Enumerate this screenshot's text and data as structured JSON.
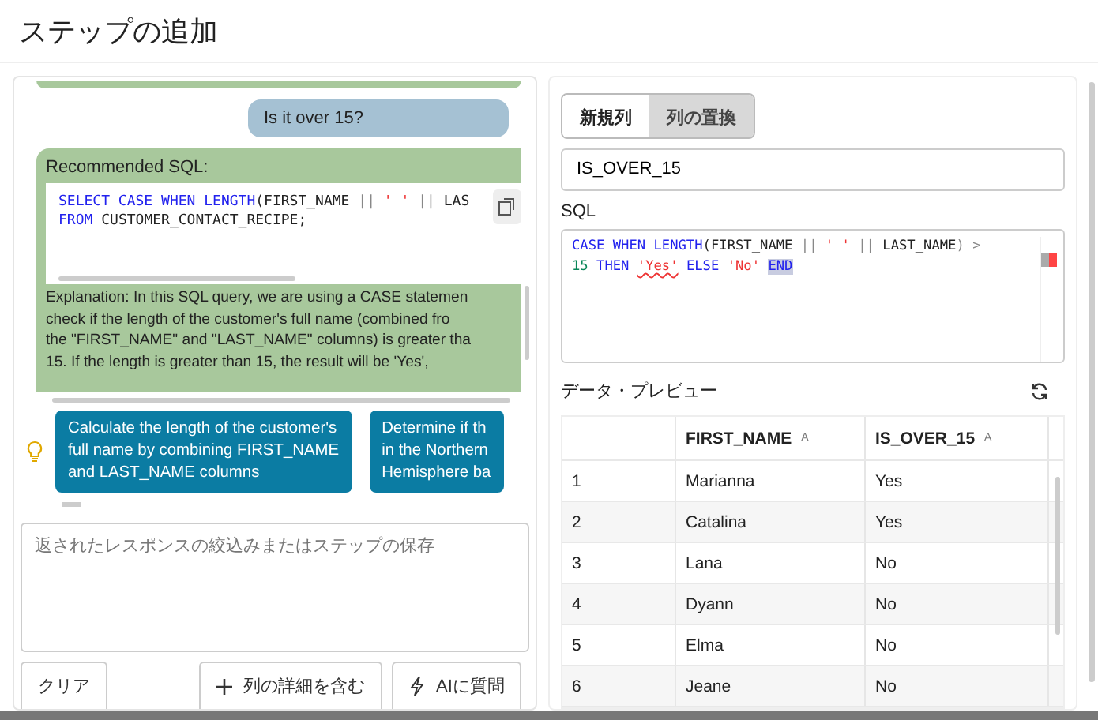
{
  "title": "ステップの追加",
  "chat": {
    "user_message": "Is it over 15?",
    "recommendation": {
      "heading": "Recommended SQL:",
      "code_lines": [
        [
          {
            "kind": "keyword",
            "text": "SELECT CASE WHEN LENGTH"
          },
          {
            "kind": "plain",
            "text": "(FIRST_NAME "
          },
          {
            "kind": "operator",
            "text": "||"
          },
          {
            "kind": "string",
            "text": " ' ' "
          },
          {
            "kind": "operator",
            "text": "||"
          },
          {
            "kind": "plain",
            "text": " LAS"
          }
        ],
        [
          {
            "kind": "keyword",
            "text": "FROM"
          },
          {
            "kind": "plain",
            "text": " CUSTOMER_CONTACT_RECIPE;"
          }
        ]
      ],
      "explanation_lines": [
        "Explanation: In this SQL query, we are using a CASE statemen",
        "check if the length of the customer's full name (combined fro",
        "the \"FIRST_NAME\" and \"LAST_NAME\" columns) is greater tha",
        "15. If the length is greater than 15, the result will be 'Yes',"
      ]
    }
  },
  "suggestions": [
    {
      "lines": [
        "Calculate the length of the customer's",
        "full name by combining FIRST_NAME",
        "and LAST_NAME columns"
      ]
    },
    {
      "lines": [
        "Determine if th",
        "in the Northern",
        "Hemisphere ba"
      ]
    }
  ],
  "prompt": {
    "placeholder": "返されたレスポンスの絞込みまたはステップの保存"
  },
  "buttons": [
    {
      "kind": "plain",
      "label": "クリア"
    },
    {
      "kind": "add",
      "label": "列の詳細を含む"
    },
    {
      "kind": "ai",
      "label": "AIに質問"
    }
  ],
  "tabs": [
    {
      "label": "新規列",
      "selected": true
    },
    {
      "label": "列の置換",
      "selected": false
    }
  ],
  "column_name": "IS_OVER_15",
  "sql_label": "SQL",
  "sql_lines": [
    [
      {
        "kind": "keyword",
        "text": "CASE WHEN LENGTH"
      },
      {
        "kind": "plain",
        "text": "(FIRST_NAME "
      },
      {
        "kind": "operator",
        "text": "||"
      },
      {
        "kind": "string",
        "text": " ' ' "
      },
      {
        "kind": "operator",
        "text": "||"
      },
      {
        "kind": "plain",
        "text": " LAST_NAME"
      },
      {
        "kind": "operator",
        "text": ") >"
      }
    ],
    [
      {
        "kind": "number",
        "text": "15"
      },
      {
        "kind": "keyword",
        "text": " THEN "
      },
      {
        "kind": "string_error",
        "text": "'Yes'"
      },
      {
        "kind": "keyword",
        "text": " ELSE "
      },
      {
        "kind": "string",
        "text": "'No' "
      },
      {
        "kind": "keyword_selected",
        "text": "END"
      }
    ]
  ],
  "preview": {
    "title": "データ・プレビュー",
    "columns": [
      {},
      {
        "label": "FIRST_NAME",
        "sort": "A"
      },
      {
        "label": "IS_OVER_15",
        "sort": "A"
      }
    ],
    "rows": [
      [
        "1",
        "Marianna",
        "Yes"
      ],
      [
        "2",
        "Catalina",
        "Yes"
      ],
      [
        "3",
        "Lana",
        "No"
      ],
      [
        "4",
        "Dyann",
        "No"
      ],
      [
        "5",
        "Elma",
        "No"
      ],
      [
        "6",
        "Jeane",
        "No"
      ]
    ]
  }
}
